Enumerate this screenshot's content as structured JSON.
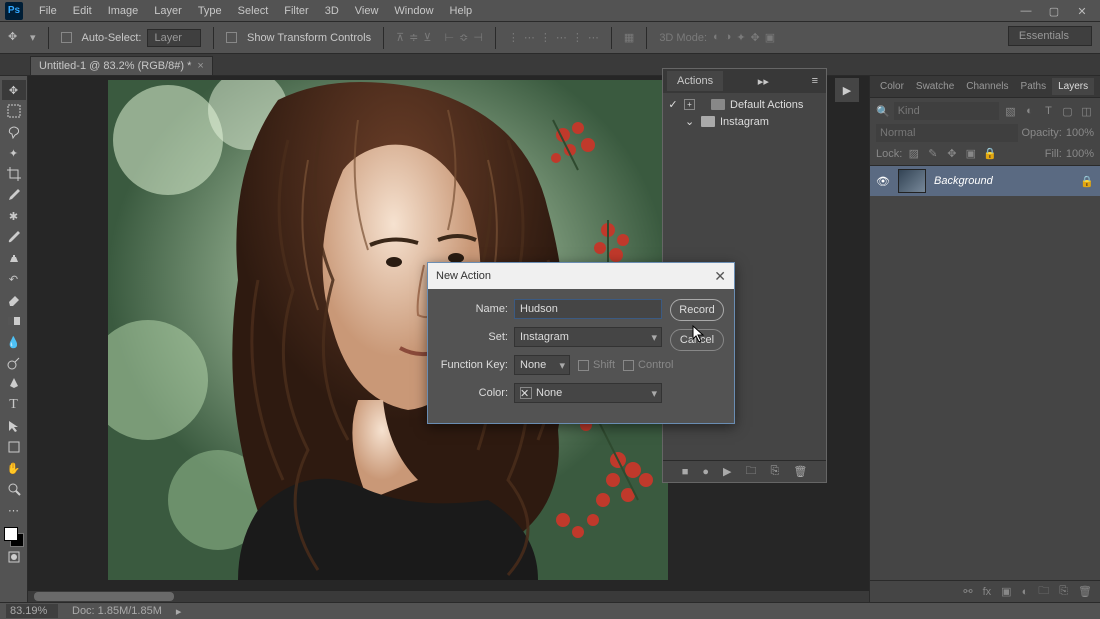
{
  "menubar": {
    "items": [
      "File",
      "Edit",
      "Image",
      "Layer",
      "Type",
      "Select",
      "Filter",
      "3D",
      "View",
      "Window",
      "Help"
    ],
    "logo": "Ps"
  },
  "optionbar": {
    "autoSelect": "Auto-Select:",
    "layerDD": "Layer",
    "showTransform": "Show Transform Controls",
    "mode3d": "3D Mode:",
    "workspace": "Essentials"
  },
  "doctab": {
    "title": "Untitled-1 @ 83.2% (RGB/8#) *"
  },
  "actionsPanel": {
    "title": "Actions",
    "rows": [
      {
        "label": "Default Actions"
      },
      {
        "label": "Instagram"
      }
    ]
  },
  "layersPanel": {
    "tabs": [
      "Color",
      "Swatche",
      "Channels",
      "Paths",
      "Layers"
    ],
    "kindPlaceholder": "Kind",
    "blend": "Normal",
    "opacityLbl": "Opacity:",
    "opacityVal": "100%",
    "lockLbl": "Lock:",
    "fillLbl": "Fill:",
    "fillVal": "100%",
    "layers": [
      {
        "name": "Background"
      }
    ]
  },
  "dialog": {
    "title": "New Action",
    "nameLbl": "Name:",
    "nameVal": "Hudson",
    "setLbl": "Set:",
    "setVal": "Instagram",
    "fkLbl": "Function Key:",
    "fkVal": "None",
    "shift": "Shift",
    "ctrl": "Control",
    "colorLbl": "Color:",
    "colorVal": "None",
    "recordBtn": "Record",
    "cancelBtn": "Cancel"
  },
  "status": {
    "zoom": "83.19%",
    "doc": "Doc: 1.85M/1.85M"
  }
}
